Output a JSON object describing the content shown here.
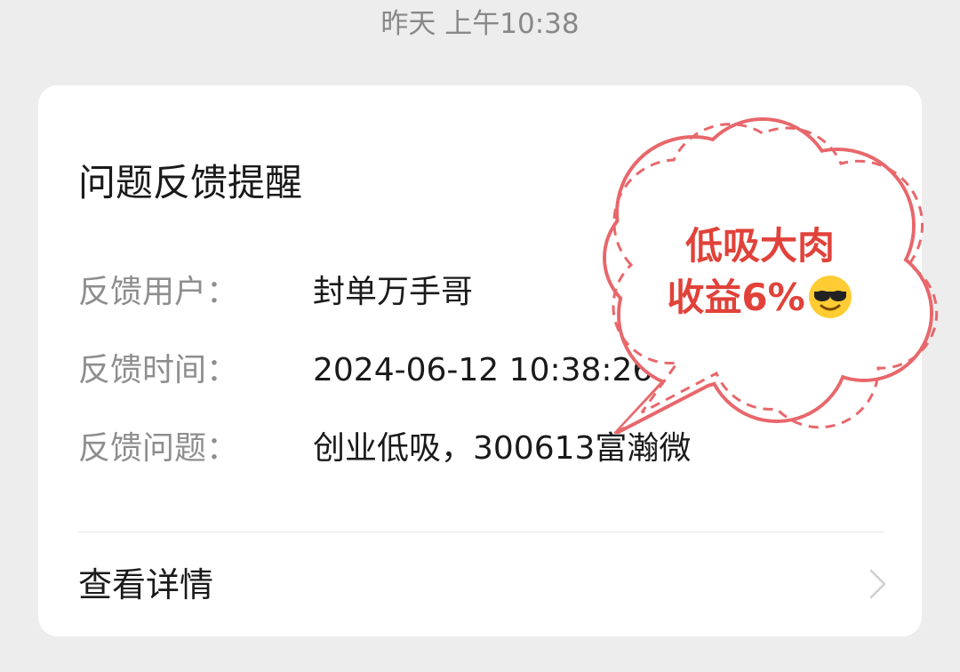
{
  "timestamp": "昨天 上午10:38",
  "card": {
    "title": "问题反馈提醒",
    "rows": [
      {
        "label": "反馈用户：",
        "value": "封单万手哥"
      },
      {
        "label": "反馈时间：",
        "value": "2024-06-12 10:38:26"
      },
      {
        "label": "反馈问题：",
        "value": "创业低吸，300613富瀚微"
      }
    ],
    "details_label": "查看详情"
  },
  "sticker": {
    "line1": "低吸大肉",
    "line2": "收益6%",
    "emoji": "sunglasses-emoji",
    "colors": {
      "border": "#e8676b",
      "text": "#e0423a"
    }
  },
  "icons": {
    "more": "more-dots-icon",
    "chevron": "chevron-right-icon"
  }
}
